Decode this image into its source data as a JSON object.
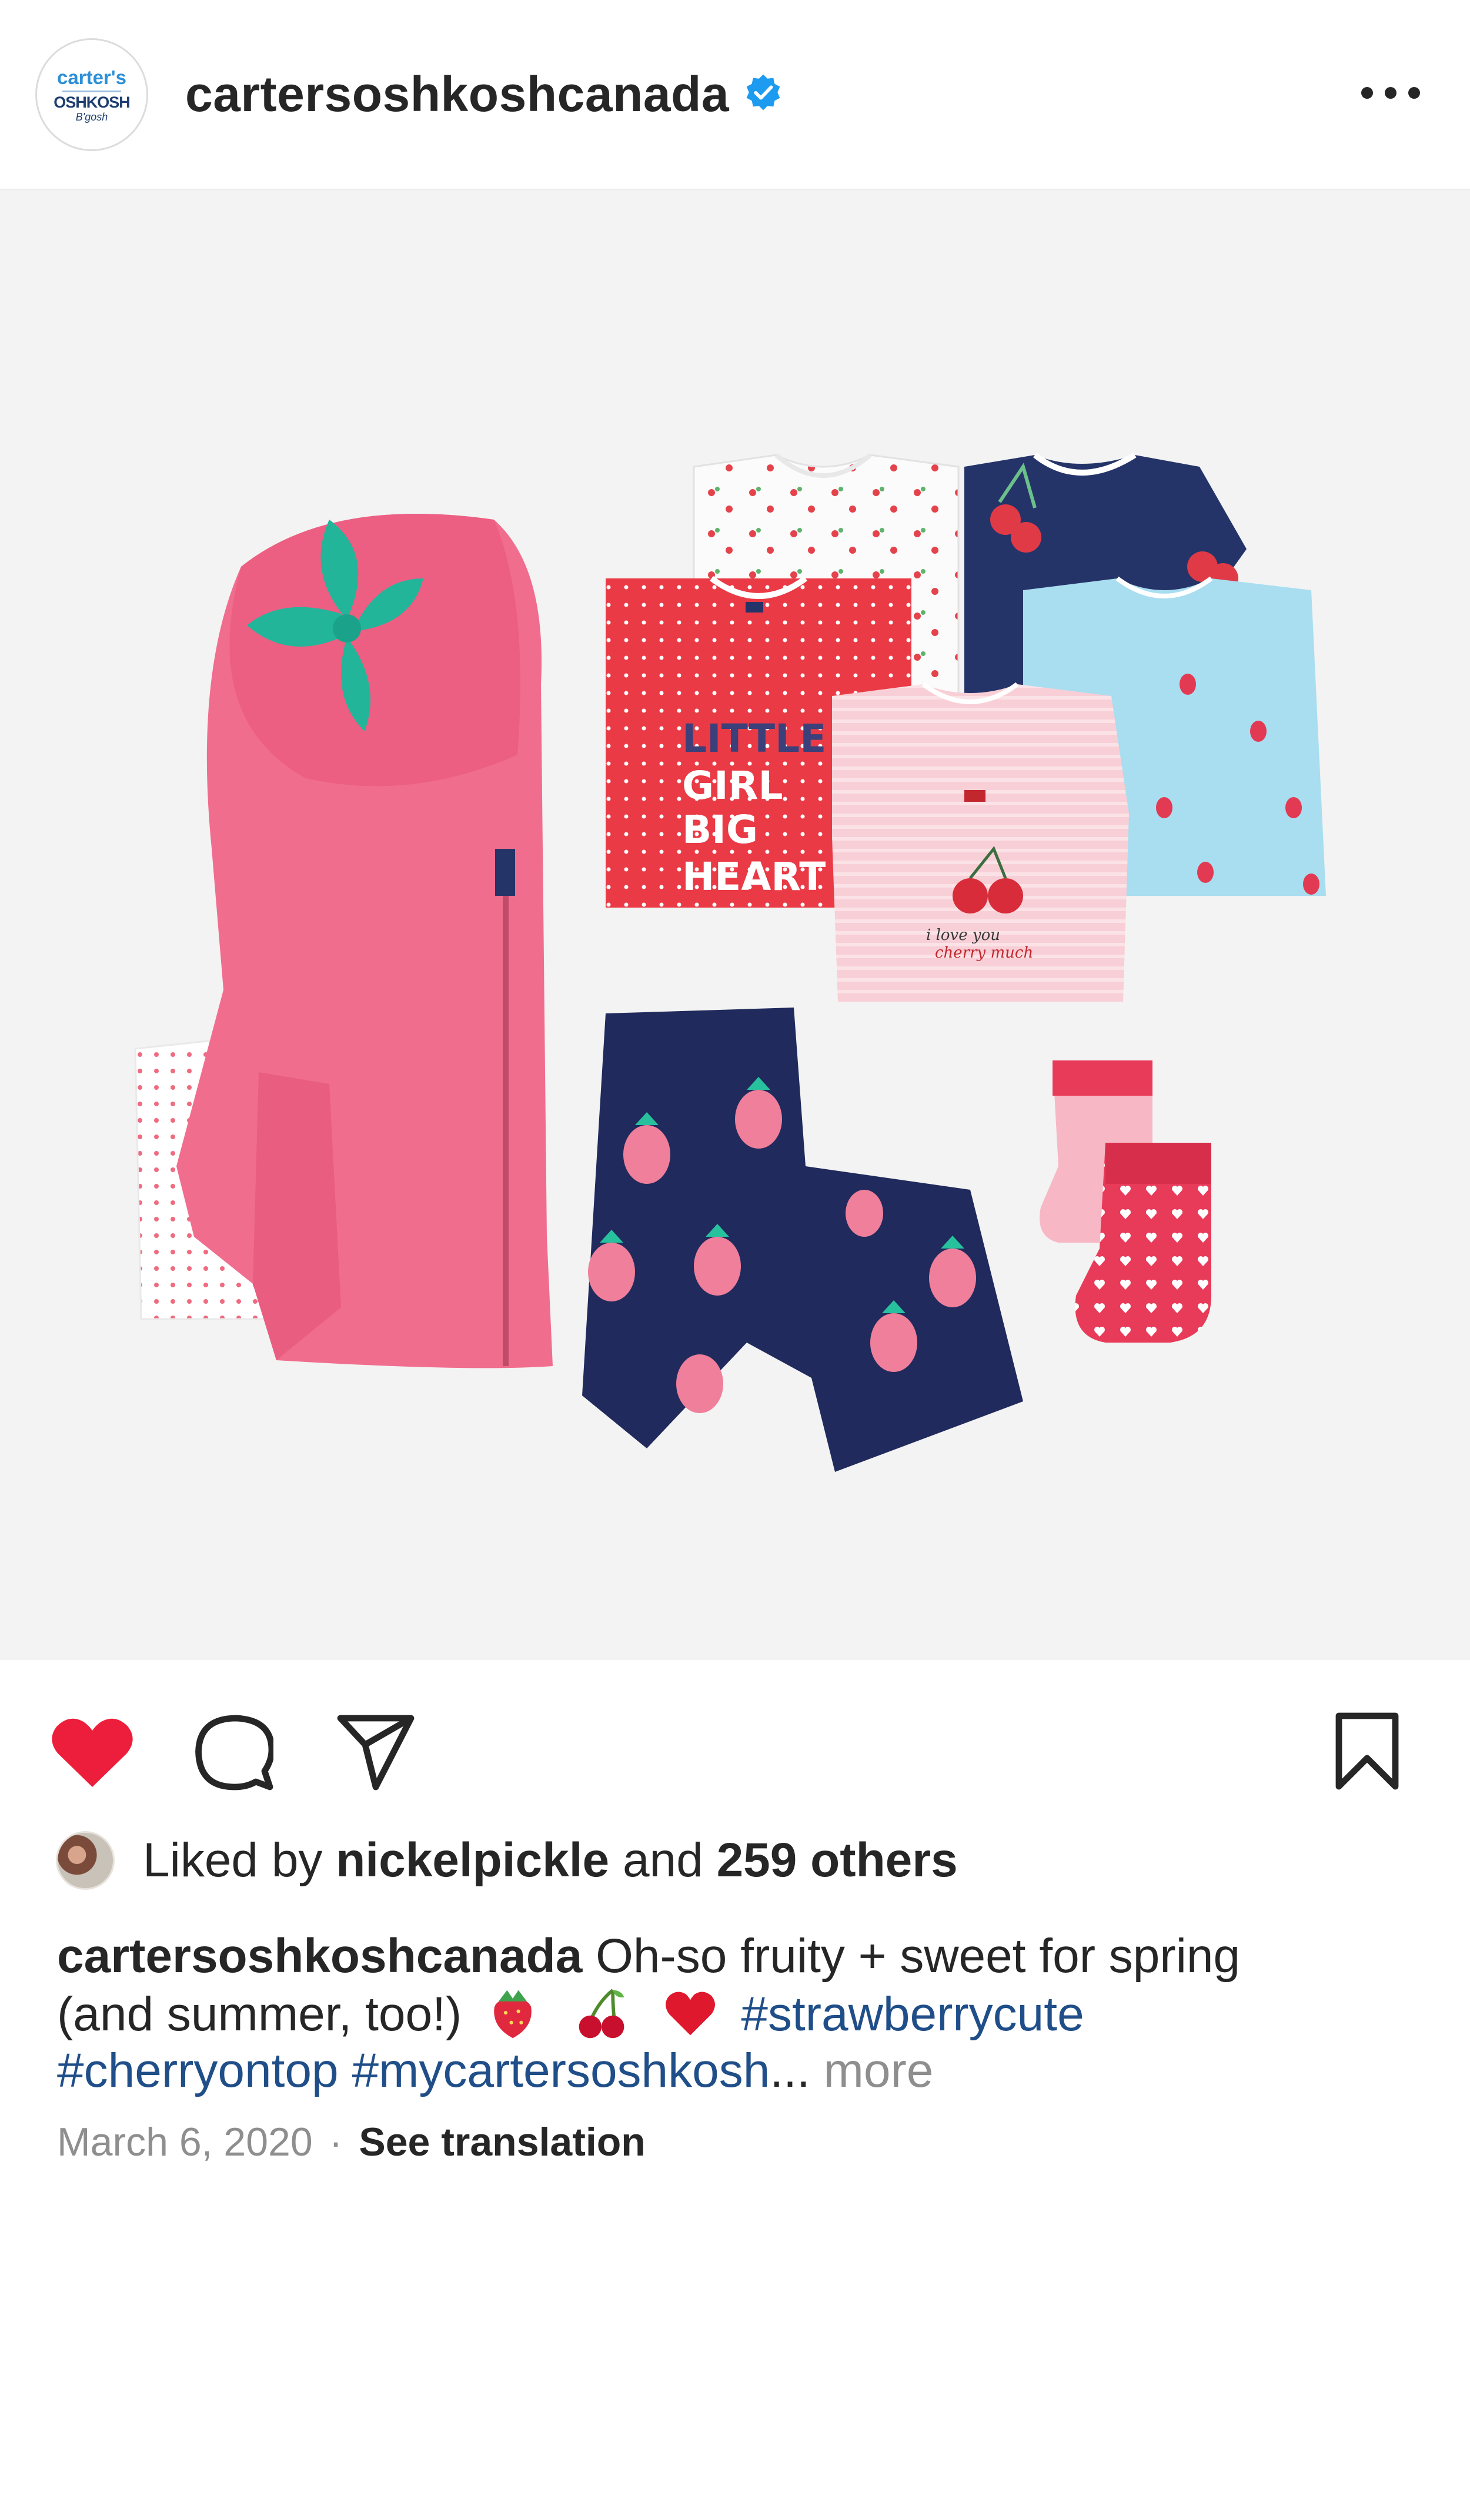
{
  "header": {
    "username": "cartersoshkoshcanada",
    "avatar": {
      "line1": "carter's",
      "line2": "OSHKOSH",
      "line3": "B'gosh"
    },
    "verified_icon": "verified-badge-icon",
    "more_icon": "more-options-icon"
  },
  "post": {
    "image": {
      "text": [
        "LITTLE",
        "GIRL",
        "BIG",
        "HEART"
      ],
      "cherry_text": [
        "i love you",
        "cherry much"
      ]
    },
    "actions": {
      "like_icon": "heart-filled-icon",
      "comment_icon": "comment-icon",
      "share_icon": "share-icon",
      "save_icon": "bookmark-icon",
      "like_color": "#ed1e3b"
    },
    "likes": {
      "prefix": "Liked by",
      "user": "nickelpickle",
      "middle": "and",
      "others": "259 others"
    },
    "caption": {
      "user": "cartersoshkoshcanada",
      "text_part1": "Oh-so fruity + sweet for spring",
      "text_part2": "(and summer, too!)",
      "emoji": [
        "strawberry-icon",
        "cherries-icon",
        "red-heart-icon"
      ],
      "tags": [
        "#strawberrycute",
        "#cherryontop",
        "#mycartersoshkosh"
      ],
      "ellipsis": "...",
      "more": "more"
    },
    "date": "March 6, 2020",
    "separator": "·",
    "translation": "See translation"
  }
}
